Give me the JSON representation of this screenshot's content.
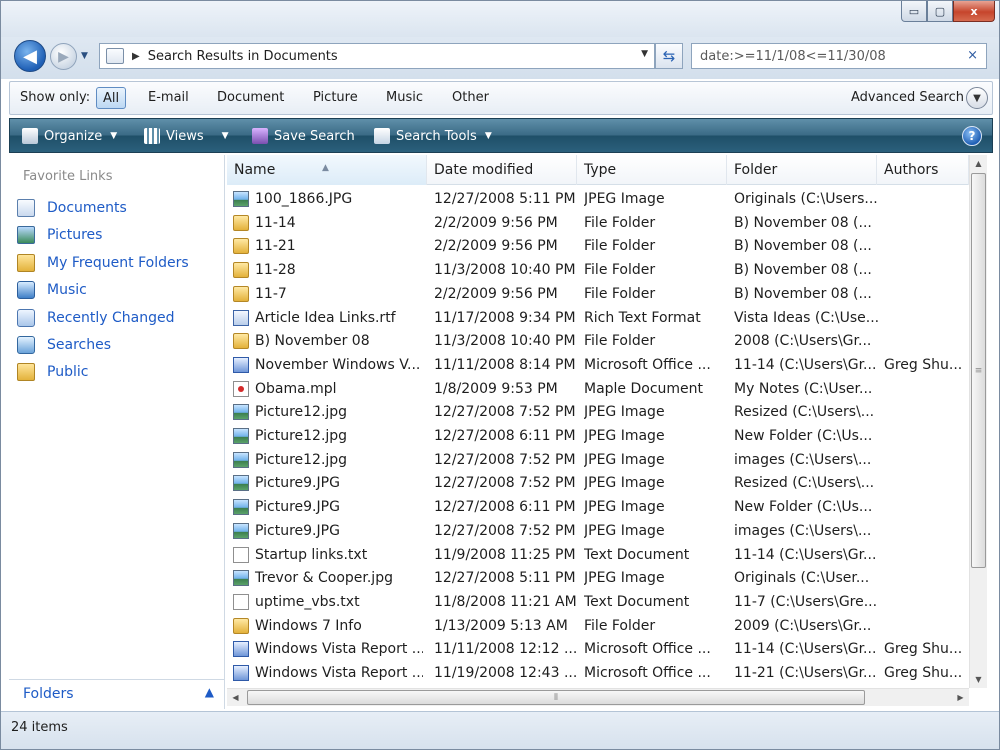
{
  "window": {
    "caption_buttons": {
      "minimize": "▭",
      "maximize": "▢",
      "close": "x"
    }
  },
  "address": {
    "path": "Search Results in Documents"
  },
  "search": {
    "query": "date:>=11/1/08<=11/30/08",
    "clear_label": "×"
  },
  "filter_bar": {
    "label": "Show only:",
    "filters": [
      "All",
      "E-mail",
      "Document",
      "Picture",
      "Music",
      "Other"
    ],
    "active": "All",
    "advanced_label": "Advanced Search"
  },
  "toolbar": {
    "organize": "Organize",
    "views": "Views",
    "save_search": "Save Search",
    "search_tools": "Search Tools",
    "help": "?"
  },
  "left_pane": {
    "title": "Favorite Links",
    "links": [
      {
        "label": "Documents",
        "icon": "documents-icon"
      },
      {
        "label": "Pictures",
        "icon": "pictures-icon"
      },
      {
        "label": "My Frequent Folders",
        "icon": "folder-icon"
      },
      {
        "label": "Music",
        "icon": "music-icon"
      },
      {
        "label": "Recently Changed",
        "icon": "recently-changed-icon"
      },
      {
        "label": "Searches",
        "icon": "searches-icon"
      },
      {
        "label": "Public",
        "icon": "folder-icon"
      }
    ],
    "folders_label": "Folders"
  },
  "columns": [
    "Name",
    "Date modified",
    "Type",
    "Folder",
    "Authors"
  ],
  "files": [
    {
      "icon": "jpg",
      "name": "100_1866.JPG",
      "date": "12/27/2008 5:11 PM",
      "type": "JPEG Image",
      "folder": "Originals (C:\\Users...",
      "authors": ""
    },
    {
      "icon": "folder",
      "name": "11-14",
      "date": "2/2/2009 9:56 PM",
      "type": "File Folder",
      "folder": "B) November 08 (...",
      "authors": ""
    },
    {
      "icon": "folder",
      "name": "11-21",
      "date": "2/2/2009 9:56 PM",
      "type": "File Folder",
      "folder": "B) November 08 (...",
      "authors": ""
    },
    {
      "icon": "folder",
      "name": "11-28",
      "date": "11/3/2008 10:40 PM",
      "type": "File Folder",
      "folder": "B) November 08 (...",
      "authors": ""
    },
    {
      "icon": "folder",
      "name": "11-7",
      "date": "2/2/2009 9:56 PM",
      "type": "File Folder",
      "folder": "B) November 08 (...",
      "authors": ""
    },
    {
      "icon": "doc",
      "name": "Article Idea Links.rtf",
      "date": "11/17/2008 9:34 PM",
      "type": "Rich Text Format",
      "folder": "Vista Ideas (C:\\Use...",
      "authors": ""
    },
    {
      "icon": "folder",
      "name": "B) November 08",
      "date": "11/3/2008 10:40 PM",
      "type": "File Folder",
      "folder": "2008 (C:\\Users\\Gr...",
      "authors": ""
    },
    {
      "icon": "office",
      "name": "November  Windows V...",
      "date": "11/11/2008 8:14 PM",
      "type": "Microsoft Office ...",
      "folder": "11-14 (C:\\Users\\Gr...",
      "authors": "Greg Shu..."
    },
    {
      "icon": "mpl",
      "name": "Obama.mpl",
      "date": "1/8/2009 9:53 PM",
      "type": "Maple Document",
      "folder": "My Notes (C:\\User...",
      "authors": ""
    },
    {
      "icon": "jpg",
      "name": "Picture12.jpg",
      "date": "12/27/2008 7:52 PM",
      "type": "JPEG Image",
      "folder": "Resized (C:\\Users\\...",
      "authors": ""
    },
    {
      "icon": "jpg",
      "name": "Picture12.jpg",
      "date": "12/27/2008 6:11 PM",
      "type": "JPEG Image",
      "folder": "New Folder (C:\\Us...",
      "authors": ""
    },
    {
      "icon": "jpg",
      "name": "Picture12.jpg",
      "date": "12/27/2008 7:52 PM",
      "type": "JPEG Image",
      "folder": "images (C:\\Users\\...",
      "authors": ""
    },
    {
      "icon": "jpg",
      "name": "Picture9.JPG",
      "date": "12/27/2008 7:52 PM",
      "type": "JPEG Image",
      "folder": "Resized (C:\\Users\\...",
      "authors": ""
    },
    {
      "icon": "jpg",
      "name": "Picture9.JPG",
      "date": "12/27/2008 6:11 PM",
      "type": "JPEG Image",
      "folder": "New Folder (C:\\Us...",
      "authors": ""
    },
    {
      "icon": "jpg",
      "name": "Picture9.JPG",
      "date": "12/27/2008 7:52 PM",
      "type": "JPEG Image",
      "folder": "images (C:\\Users\\...",
      "authors": ""
    },
    {
      "icon": "txt",
      "name": "Startup links.txt",
      "date": "11/9/2008 11:25 PM",
      "type": "Text Document",
      "folder": "11-14 (C:\\Users\\Gr...",
      "authors": ""
    },
    {
      "icon": "jpg",
      "name": "Trevor & Cooper.jpg",
      "date": "12/27/2008 5:11 PM",
      "type": "JPEG Image",
      "folder": "Originals (C:\\User...",
      "authors": ""
    },
    {
      "icon": "txt",
      "name": "uptime_vbs.txt",
      "date": "11/8/2008 11:21 AM",
      "type": "Text Document",
      "folder": "11-7 (C:\\Users\\Gre...",
      "authors": ""
    },
    {
      "icon": "folder",
      "name": "Windows 7 Info",
      "date": "1/13/2009 5:13 AM",
      "type": "File Folder",
      "folder": "2009 (C:\\Users\\Gr...",
      "authors": ""
    },
    {
      "icon": "office",
      "name": "Windows Vista Report ...",
      "date": "11/11/2008 12:12 ...",
      "type": "Microsoft Office ...",
      "folder": "11-14 (C:\\Users\\Gr...",
      "authors": "Greg Shu..."
    },
    {
      "icon": "office",
      "name": "Windows Vista Report ...",
      "date": "11/19/2008 12:43 ...",
      "type": "Microsoft Office ...",
      "folder": "11-21 (C:\\Users\\Gr...",
      "authors": "Greg Shu..."
    }
  ],
  "status": {
    "count": "24 items"
  }
}
